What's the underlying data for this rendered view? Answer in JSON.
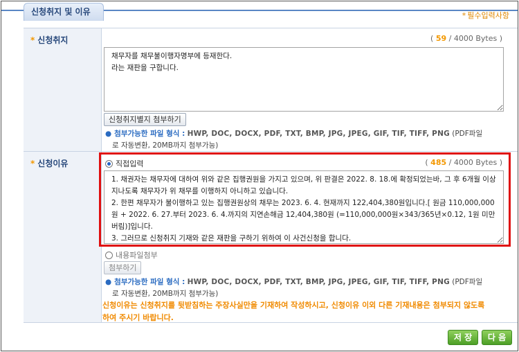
{
  "section": {
    "title": "신청취지 및 이유",
    "required_note": "필수입력사항",
    "required_star": "*"
  },
  "purpose": {
    "label": "신청취지",
    "star": "*",
    "bytes_open": "(",
    "bytes_used": "59",
    "bytes_total": "/ 4000 Bytes )",
    "text": "채무자를 채무불이행자명부에 등재한다.\n라는 재판을 구합니다.",
    "attach_button": "신청취지별지 첨부하기",
    "hint_dot": "●",
    "hint_label": "첨부가능한 파일 형식 :",
    "hint_formats": "HWP, DOC, DOCX, PDF, TXT, BMP, JPG, JPEG, GIF, TIF, TIFF, PNG",
    "hint_tail": "(PDF파일",
    "hint_line2": "로 자동변환, 20MB까지 첨부가능)"
  },
  "reason": {
    "label": "신청이유",
    "star": "*",
    "radio_direct": "직접입력",
    "radio_direct_checked": true,
    "bytes_open": "(",
    "bytes_used": "485",
    "bytes_total": "/ 4000 Bytes )",
    "text": "1. 채권자는 채무자에 대하여 위와 같은 집행권원을 가지고 있으며, 위 판결은 2022. 8. 18.에 확정되었는바, 그 후 6개월 이상 지나도록 채무자가 위 채무를 이행하지 아니하고 있습니다.\n2. 한편 채무자가 불이행하고 있는 집행권원상의 채무는 2023. 6. 4. 현재까지 122,404,380원입니다.[ 원금 110,000,000원 + 2022. 6. 27.부터 2023. 6. 4.까지의 지연손해금 12,404,380원 (=110,000,000원×343/365년×0.12, 1원 미만 버림)]입니다.\n3. 그러므로 신청취지 기재와 같은 재판을 구하기 위하여 이 사건신청을 합니다.",
    "radio_file": "내용파일첨부",
    "radio_file_checked": false,
    "attach_button": "첨부하기",
    "hint_dot": "●",
    "hint_label": "첨부가능한 파일 형식 :",
    "hint_formats": "HWP, DOC, DOCX, PDF, TXT, BMP, JPG, JPEG, GIF, TIF, TIFF, PNG",
    "hint_tail": "(PDF파일",
    "hint_line2": "로 자동변환, 20MB까지 첨부가능)",
    "notice": "신청이유는 신청취지를 뒷받침하는 주장사실만을 기재하여 작성하시고, 신청이유 이외 다른 기재내용은 첨부되지 않도록 하여 주시기 바랍니다."
  },
  "actions": {
    "save": "저 장",
    "next": "다 음"
  },
  "colors": {
    "accent_blue": "#26477a",
    "star_orange": "#f39800",
    "highlight_red": "#e01010",
    "button_green": "#4d9f26"
  }
}
